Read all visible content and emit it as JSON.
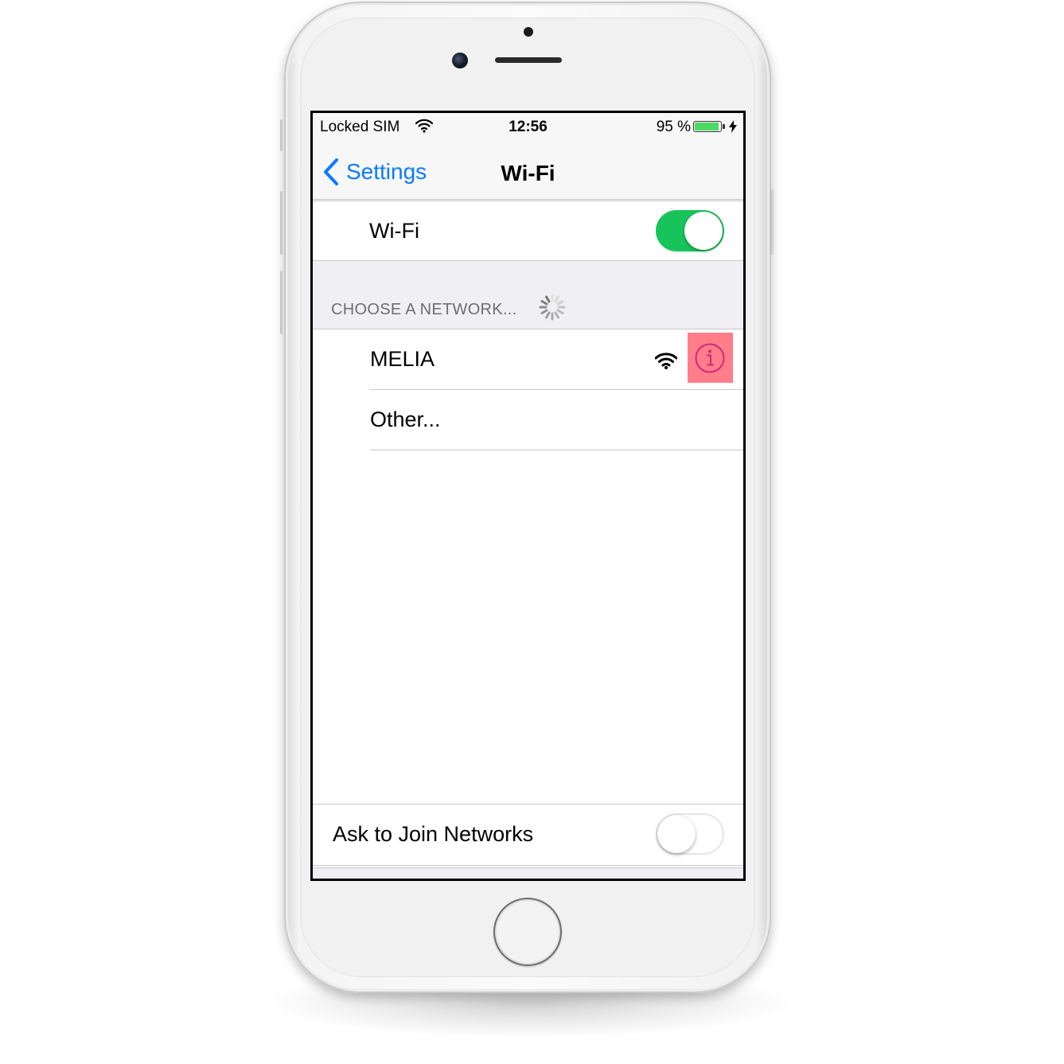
{
  "status_bar": {
    "carrier": "Locked SIM",
    "time": "12:56",
    "battery_text": "95 %",
    "battery_level": 0.95,
    "icons": [
      "wifi-icon",
      "battery-icon",
      "charging-bolt-icon"
    ]
  },
  "nav": {
    "back_label": "Settings",
    "title": "Wi-Fi",
    "accent_color": "#0a7aff"
  },
  "wifi_toggle": {
    "label": "Wi-Fi",
    "on": true,
    "on_color": "#17c45b"
  },
  "networks": {
    "header": "CHOOSE A NETWORK...",
    "items": [
      {
        "name": "MELIA",
        "icons": [
          "wifi-strength-icon",
          "info-icon"
        ],
        "highlight_color": "#ff7e8a"
      },
      {
        "name": "Other..."
      }
    ]
  },
  "ask_to_join": {
    "label": "Ask to Join Networks",
    "on": false
  }
}
